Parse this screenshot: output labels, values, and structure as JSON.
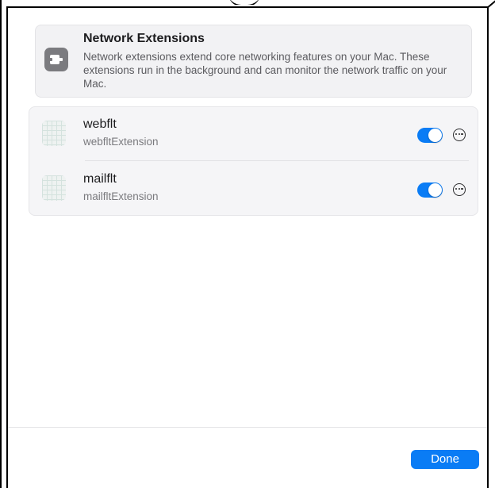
{
  "header": {
    "title": "Network Extensions",
    "description": "Network extensions extend core networking features on your Mac. These extensions run in the background and can monitor the network traffic on your Mac.",
    "icon": "plug-icon"
  },
  "extensions": [
    {
      "name": "webflt",
      "identifier": "webfltExtension",
      "enabled": true,
      "icon": "app-grid-icon"
    },
    {
      "name": "mailflt",
      "identifier": "mailfltExtension",
      "enabled": true,
      "icon": "app-grid-icon"
    }
  ],
  "footer": {
    "done_label": "Done"
  },
  "colors": {
    "accent": "#0a7cf5",
    "card_bg": "#f2f2f4"
  }
}
